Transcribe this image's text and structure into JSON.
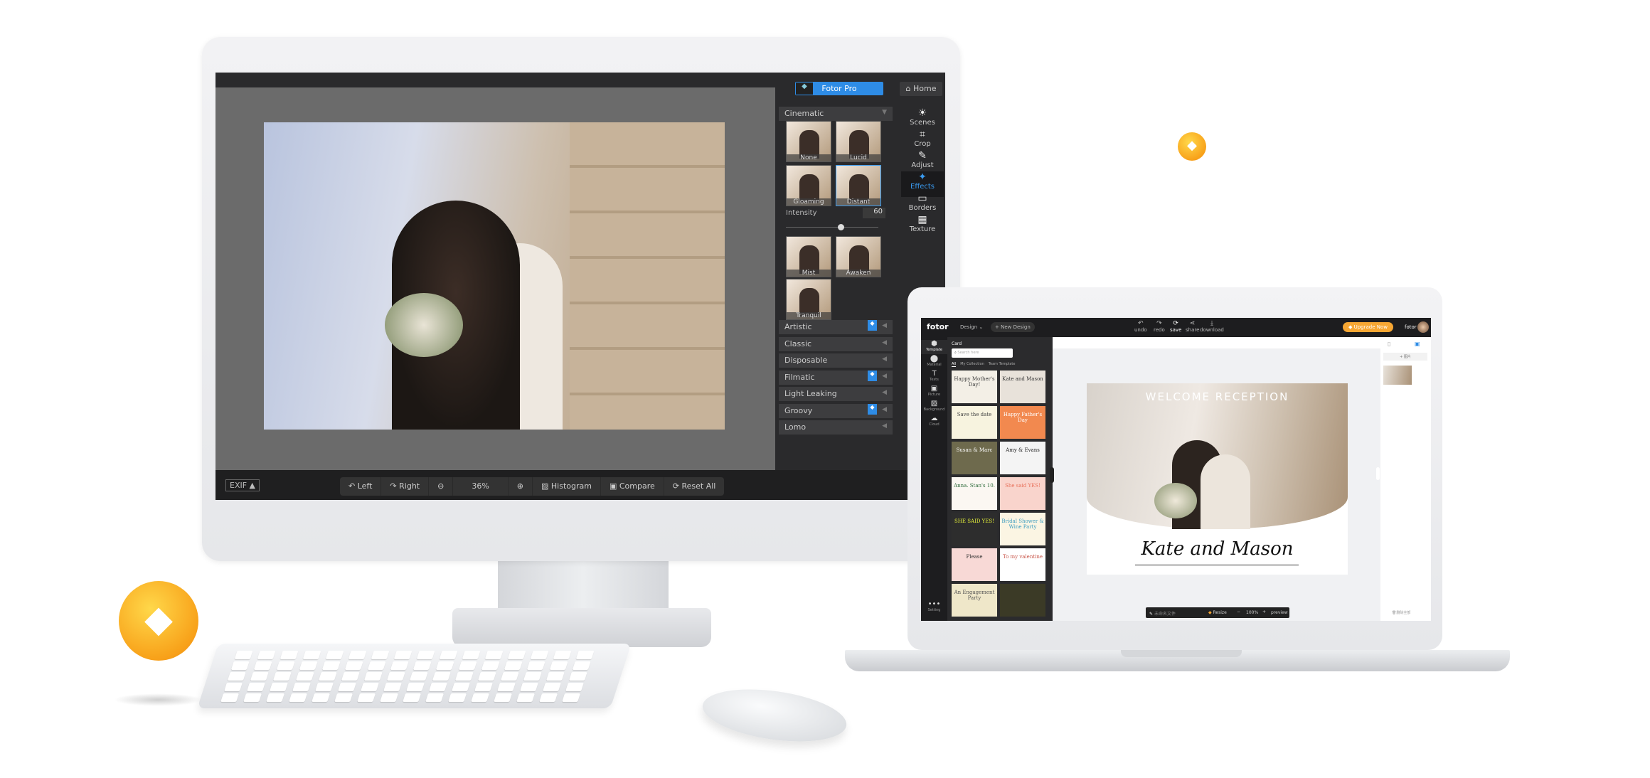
{
  "monitor": {
    "header": {
      "pro_label": "Fotor Pro",
      "home_label": "Home"
    },
    "effects": {
      "open_category": "Cinematic",
      "thumbs": [
        "None",
        "Lucid",
        "Gloaming",
        "Distant",
        "Mist",
        "Awaken",
        "Tranquil"
      ],
      "selected": "Distant",
      "intensity_label": "Intensity",
      "intensity_value": "60",
      "intensity_fraction": 0.6,
      "categories": [
        {
          "label": "Artistic",
          "pro": true
        },
        {
          "label": "Classic",
          "pro": false
        },
        {
          "label": "Disposable",
          "pro": false
        },
        {
          "label": "Filmatic",
          "pro": true
        },
        {
          "label": "Light Leaking",
          "pro": false
        },
        {
          "label": "Groovy",
          "pro": true
        },
        {
          "label": "Lomo",
          "pro": false
        }
      ]
    },
    "tools": [
      {
        "label": "Scenes",
        "icon": "sun-icon"
      },
      {
        "label": "Crop",
        "icon": "crop-icon"
      },
      {
        "label": "Adjust",
        "icon": "pencil-icon"
      },
      {
        "label": "Effects",
        "icon": "sparkle-icon",
        "active": true
      },
      {
        "label": "Borders",
        "icon": "frame-icon"
      },
      {
        "label": "Texture",
        "icon": "texture-icon"
      }
    ],
    "toolbar": {
      "exif": "EXIF ▲",
      "left": "Left",
      "right": "Right",
      "zoom": "36%",
      "histogram": "Histogram",
      "compare": "Compare",
      "reset": "Reset  All"
    }
  },
  "laptop": {
    "topbar": {
      "logo": "fotor",
      "design": "Design ⌄",
      "new_design": "+ New Design",
      "undo": "undo",
      "redo": "redo",
      "save": "save",
      "share": "share",
      "download": "download",
      "upgrade": "Upgrade Now",
      "user": "fotor"
    },
    "sidebar": [
      "Template",
      "Material",
      "Texts",
      "Picture",
      "Background",
      "Cloud"
    ],
    "setting": "Setting",
    "panel": {
      "title": "Card",
      "search_placeholder": "Search here",
      "tabs": [
        "All",
        "My Collection",
        "Team Template"
      ]
    },
    "templates": [
      {
        "text": "Happy Mother's Day!",
        "bg": "#f3efe6",
        "fg": "#3a3a3a"
      },
      {
        "text": "Kate and Mason",
        "bg": "#e8e2da",
        "fg": "#333"
      },
      {
        "text": "Save the date",
        "bg": "#f7f3df",
        "fg": "#444"
      },
      {
        "text": "Happy Father's Day",
        "bg": "#f2894f",
        "fg": "#fff"
      },
      {
        "text": "Susan & Marc",
        "bg": "#6e6a4d",
        "fg": "#fff"
      },
      {
        "text": "Amy & Evans",
        "bg": "#f4f4f4",
        "fg": "#222"
      },
      {
        "text": "Anna. Stan's 10.",
        "bg": "#fbf7f2",
        "fg": "#2e6b3b"
      },
      {
        "text": "She said YES!",
        "bg": "#f9d4cc",
        "fg": "#e9735d"
      },
      {
        "text": "SHE SAID YES!",
        "bg": "#2d2d2d",
        "fg": "#e6f23a"
      },
      {
        "text": "Bridal Shower & Wine Party",
        "bg": "#fbf5e3",
        "fg": "#3a9bbf"
      },
      {
        "text": "Please",
        "bg": "#f8d9d6",
        "fg": "#333"
      },
      {
        "text": "To my valentine",
        "bg": "#fff",
        "fg": "#c9564a"
      },
      {
        "text": "An Engagement Party",
        "bg": "#efe7c9",
        "fg": "#555"
      },
      {
        "text": "",
        "bg": "#3b3a26",
        "fg": "#fff"
      }
    ],
    "card": {
      "title": "WELCOME RECEPTION",
      "names": "Kate and Mason"
    },
    "right_panel": {
      "add_picture": "+ 图片",
      "delete_all": "删除全部"
    },
    "bottom": {
      "filename": "未命名文件",
      "resize": "Resize",
      "minus": "−",
      "zoom": "100%",
      "plus": "+",
      "preview": "preview"
    }
  },
  "colors": {
    "accent": "#2e8ce6",
    "upgrade": "#f7a733",
    "badge": "#f8a21a"
  }
}
